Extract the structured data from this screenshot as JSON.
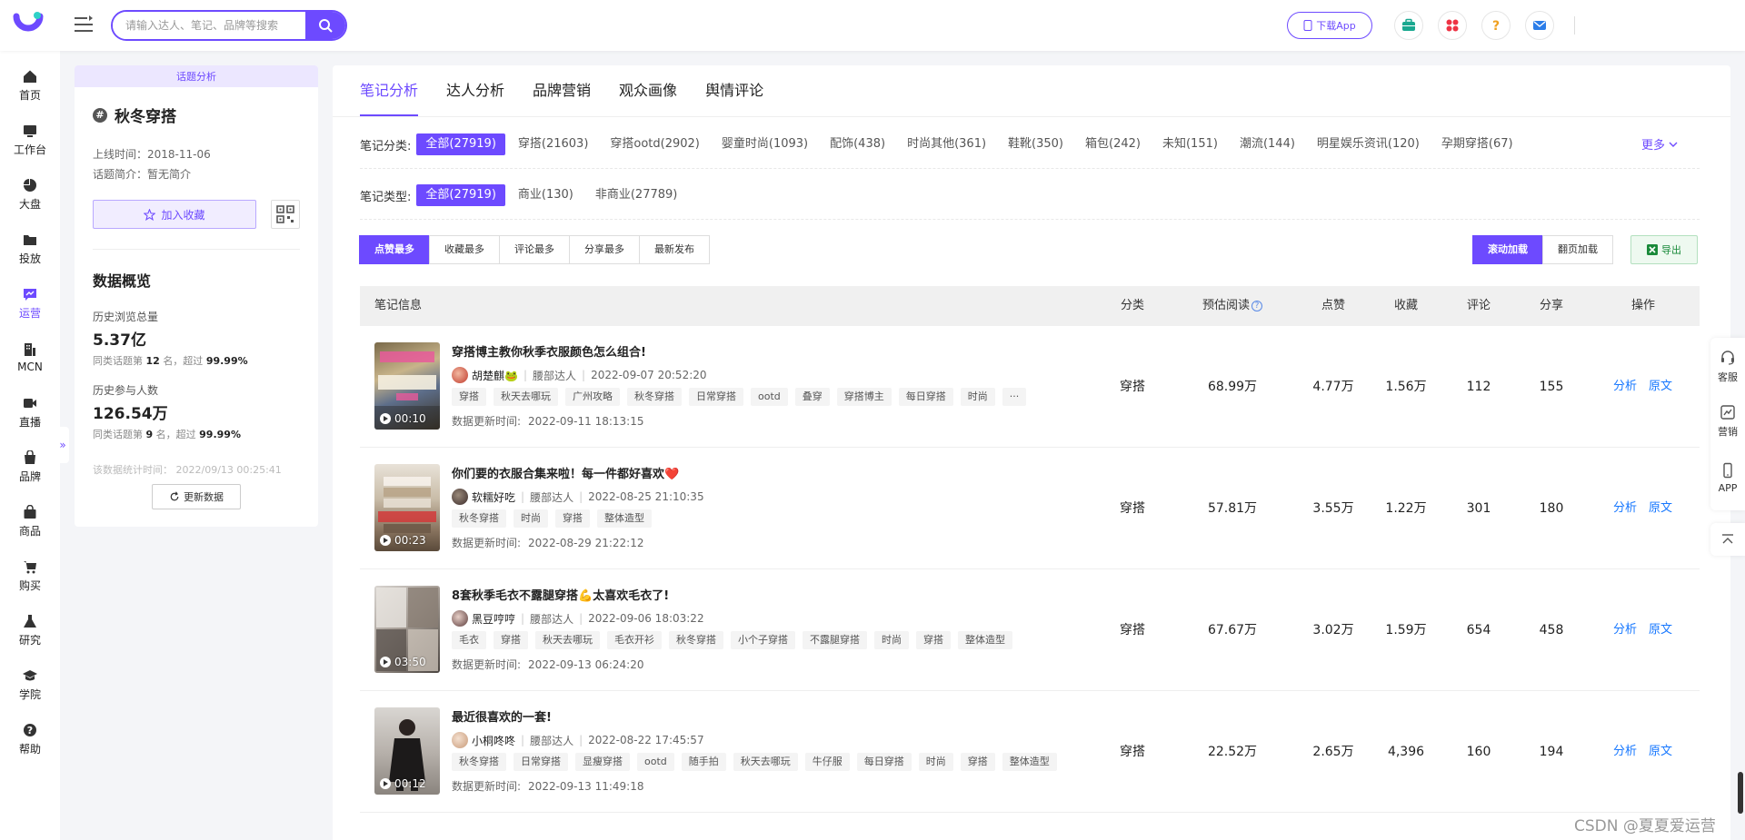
{
  "colors": {
    "accent": "#6d4aff",
    "link": "#1677ff",
    "export_green": "#1a8a3a"
  },
  "header": {
    "search_placeholder": "请输入达人、笔记、品牌等搜索",
    "download_app": "下载App",
    "icons": [
      "briefcase-icon",
      "apps-icon",
      "help-icon",
      "mail-icon"
    ]
  },
  "nav": {
    "items": [
      {
        "label": "首页",
        "icon": "home-icon"
      },
      {
        "label": "工作台",
        "icon": "monitor-icon"
      },
      {
        "label": "大盘",
        "icon": "pie-chart-icon"
      },
      {
        "label": "投放",
        "icon": "folder-icon"
      },
      {
        "label": "运营",
        "icon": "chart-bubble-icon"
      },
      {
        "label": "MCN",
        "icon": "building-icon"
      },
      {
        "label": "直播",
        "icon": "video-icon"
      },
      {
        "label": "品牌",
        "icon": "brand-bag-icon"
      },
      {
        "label": "商品",
        "icon": "shopping-bag-icon"
      },
      {
        "label": "购买",
        "icon": "cart-icon"
      },
      {
        "label": "研究",
        "icon": "flask-icon"
      },
      {
        "label": "学院",
        "icon": "graduation-cap-icon"
      },
      {
        "label": "帮助",
        "icon": "help-circle-icon"
      }
    ]
  },
  "topic": {
    "header": "话题分析",
    "name": "秋冬穿搭",
    "online_time": "上线时间：2018-11-06",
    "intro": "话题简介：暂无简介",
    "fav_button": "加入收藏",
    "overview_title": "数据概览",
    "views_label": "历史浏览总量",
    "views_value": "5.37亿",
    "views_rank_prefix": "同类话题第",
    "views_rank": "12",
    "views_rank_mid": "名，超过",
    "views_pct": "99.99%",
    "participants_label": "历史参与人数",
    "participants_value": "126.54万",
    "participants_rank_prefix": "同类话题第",
    "participants_rank": "9",
    "participants_rank_mid": "名，超过",
    "participants_pct": "99.99%",
    "stat_time": "该数据统计时间：  2022/09/13 00:25:41",
    "update_button": "更新数据"
  },
  "tabs": [
    "笔记分析",
    "达人分析",
    "品牌营销",
    "观众画像",
    "舆情评论"
  ],
  "filters": {
    "category_label": "笔记分类:",
    "categories": [
      "全部(27919)",
      "穿搭(21603)",
      "穿搭ootd(2902)",
      "婴童时尚(1093)",
      "配饰(438)",
      "时尚其他(361)",
      "鞋靴(350)",
      "箱包(242)",
      "未知(151)",
      "潮流(144)",
      "明星娱乐资讯(120)",
      "孕期穿搭(67)"
    ],
    "more": "更多",
    "type_label": "笔记类型:",
    "types": [
      "全部(27919)",
      "商业(130)",
      "非商业(27789)"
    ]
  },
  "sort": {
    "options": [
      "点赞最多",
      "收藏最多",
      "评论最多",
      "分享最多",
      "最新发布"
    ],
    "load_options": [
      "滚动加载",
      "翻页加载"
    ],
    "export": "导出"
  },
  "table": {
    "headers": {
      "info": "笔记信息",
      "category": "分类",
      "reads": "预估阅读",
      "likes": "点赞",
      "favs": "收藏",
      "comments": "评论",
      "shares": "分享",
      "ops": "操作"
    },
    "op_analyze": "分析",
    "op_original": "原文",
    "rows": [
      {
        "title": "穿搭博主教你秋季衣服颜色怎么组合!",
        "author": "胡楚麒🐸",
        "author_type": "腰部达人",
        "publish_time": "2022-09-07 20:52:20",
        "tags": [
          "穿搭",
          "秋天去哪玩",
          "广州攻略",
          "秋冬穿搭",
          "日常穿搭",
          "ootd",
          "叠穿",
          "穿搭博主",
          "每日穿搭",
          "时尚",
          "···"
        ],
        "update_label": "数据更新时间:",
        "update_time": "2022-09-11 18:13:15",
        "duration": "00:10",
        "category": "穿搭",
        "reads": "68.99万",
        "likes": "4.77万",
        "favs": "1.56万",
        "comments": "112",
        "shares": "155"
      },
      {
        "title": "你们要的衣服合集来啦！每一件都好喜欢❤️",
        "author": "软糯好吃",
        "author_type": "腰部达人",
        "publish_time": "2022-08-25 21:10:35",
        "tags": [
          "秋冬穿搭",
          "时尚",
          "穿搭",
          "整体造型"
        ],
        "update_label": "数据更新时间:",
        "update_time": "2022-08-29 21:22:12",
        "duration": "00:23",
        "category": "穿搭",
        "reads": "57.81万",
        "likes": "3.55万",
        "favs": "1.22万",
        "comments": "301",
        "shares": "180"
      },
      {
        "title": "8套秋季毛衣不露腿穿搭💪太喜欢毛衣了!",
        "author": "黑豆哼哼",
        "author_type": "腰部达人",
        "publish_time": "2022-09-06 18:03:22",
        "tags": [
          "毛衣",
          "穿搭",
          "秋天去哪玩",
          "毛衣开衫",
          "秋冬穿搭",
          "小个子穿搭",
          "不露腿穿搭",
          "时尚",
          "穿搭",
          "整体造型"
        ],
        "update_label": "数据更新时间:",
        "update_time": "2022-09-13 06:24:20",
        "duration": "03:50",
        "category": "穿搭",
        "reads": "67.67万",
        "likes": "3.02万",
        "favs": "1.59万",
        "comments": "654",
        "shares": "458"
      },
      {
        "title": "最近很喜欢的一套!",
        "author": "小桐咚咚",
        "author_type": "腰部达人",
        "publish_time": "2022-08-22 17:45:57",
        "tags": [
          "秋冬穿搭",
          "日常穿搭",
          "显瘦穿搭",
          "ootd",
          "随手拍",
          "秋天去哪玩",
          "牛仔服",
          "每日穿搭",
          "时尚",
          "穿搭",
          "整体造型"
        ],
        "update_label": "数据更新时间:",
        "update_time": "2022-09-13 11:49:18",
        "duration": "00:12",
        "category": "穿搭",
        "reads": "22.52万",
        "likes": "2.65万",
        "favs": "4,396",
        "comments": "160",
        "shares": "194"
      }
    ]
  },
  "float_bar": {
    "service": "客服",
    "marketing": "营销",
    "app": "APP"
  },
  "watermark": "CSDN @夏夏爱运营"
}
